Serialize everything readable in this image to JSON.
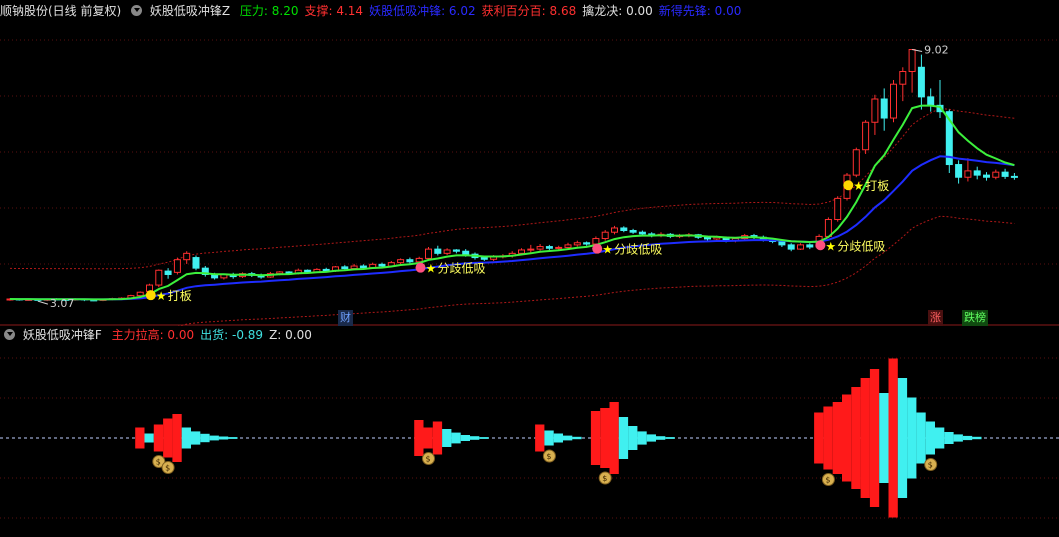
{
  "header": {
    "stock": "顺钠股份(日线 前复权)",
    "indicator": "妖股低吸冲锋Z",
    "items": [
      {
        "label": "压力: 8.20",
        "color": "#00e000"
      },
      {
        "label": "支撑: 4.14",
        "color": "#ff3030"
      },
      {
        "label": "妖股低吸冲锋: 6.02",
        "color": "#2a2aff"
      },
      {
        "label": "获利百分百: 8.68",
        "color": "#ff3030"
      },
      {
        "label": "擒龙决: 0.00",
        "color": "#e0e0e0"
      },
      {
        "label": "新得先锋: 0.00",
        "color": "#2a2aff"
      }
    ]
  },
  "sub_header": {
    "indicator": "妖股低吸冲锋F",
    "items": [
      {
        "label": "主力拉高: 0.00",
        "color": "#ff3030"
      },
      {
        "label": "出货: -0.89",
        "color": "#40e0e0"
      },
      {
        "label": "Z: 0.00",
        "color": "#e0e0e0"
      }
    ]
  },
  "tags": [
    {
      "text": "财",
      "x": 338,
      "color": "#6fa0ff",
      "bg": "#1a2a4a"
    },
    {
      "text": "涨",
      "x": 928,
      "color": "#ff6060",
      "bg": "#4a1010"
    },
    {
      "text": "跌榜",
      "x": 962,
      "color": "#60ff60",
      "bg": "#104a10"
    }
  ],
  "chart_data": [
    {
      "type": "candlestick",
      "annotations": {
        "high_label": "9.02",
        "low_label": "3.07",
        "signals": [
          {
            "text": "打板",
            "bar": 16
          },
          {
            "text": "分歧低吸",
            "bar": 45
          },
          {
            "text": "分歧低吸",
            "bar": 64
          },
          {
            "text": "分歧低吸",
            "bar": 88
          },
          {
            "text": "打板",
            "bar": 91
          }
        ]
      },
      "ylim": [
        2.6,
        9.6
      ],
      "candles": [
        [
          3.1,
          3.12,
          3.08,
          3.14
        ],
        [
          3.12,
          3.1,
          3.08,
          3.14
        ],
        [
          3.1,
          3.11,
          3.08,
          3.13
        ],
        [
          3.11,
          3.09,
          3.07,
          3.12
        ],
        [
          3.09,
          3.12,
          3.07,
          3.13
        ],
        [
          3.12,
          3.11,
          3.09,
          3.14
        ],
        [
          3.11,
          3.1,
          3.08,
          3.13
        ],
        [
          3.1,
          3.12,
          3.08,
          3.14
        ],
        [
          3.12,
          3.1,
          3.07,
          3.13
        ],
        [
          3.1,
          3.09,
          3.07,
          3.11
        ],
        [
          3.09,
          3.11,
          3.07,
          3.12
        ],
        [
          3.11,
          3.13,
          3.09,
          3.15
        ],
        [
          3.13,
          3.14,
          3.11,
          3.16
        ],
        [
          3.14,
          3.2,
          3.12,
          3.22
        ],
        [
          3.2,
          3.28,
          3.18,
          3.3
        ],
        [
          3.3,
          3.45,
          3.28,
          3.48
        ],
        [
          3.45,
          3.8,
          3.4,
          3.82
        ],
        [
          3.78,
          3.7,
          3.6,
          3.85
        ],
        [
          3.75,
          4.05,
          3.7,
          4.1
        ],
        [
          4.05,
          4.2,
          3.95,
          4.25
        ],
        [
          4.1,
          3.85,
          3.8,
          4.15
        ],
        [
          3.85,
          3.7,
          3.65,
          3.9
        ],
        [
          3.7,
          3.62,
          3.58,
          3.74
        ],
        [
          3.62,
          3.7,
          3.58,
          3.72
        ],
        [
          3.7,
          3.65,
          3.6,
          3.74
        ],
        [
          3.65,
          3.72,
          3.62,
          3.75
        ],
        [
          3.72,
          3.68,
          3.64,
          3.76
        ],
        [
          3.68,
          3.64,
          3.6,
          3.72
        ],
        [
          3.64,
          3.72,
          3.62,
          3.76
        ],
        [
          3.72,
          3.76,
          3.68,
          3.78
        ],
        [
          3.76,
          3.72,
          3.7,
          3.78
        ],
        [
          3.72,
          3.8,
          3.7,
          3.84
        ],
        [
          3.8,
          3.76,
          3.72,
          3.82
        ],
        [
          3.76,
          3.82,
          3.74,
          3.85
        ],
        [
          3.82,
          3.78,
          3.76,
          3.86
        ],
        [
          3.78,
          3.88,
          3.76,
          3.9
        ],
        [
          3.88,
          3.84,
          3.82,
          3.92
        ],
        [
          3.84,
          3.9,
          3.82,
          3.95
        ],
        [
          3.9,
          3.86,
          3.84,
          3.94
        ],
        [
          3.86,
          3.94,
          3.84,
          3.98
        ],
        [
          3.94,
          3.9,
          3.86,
          3.98
        ],
        [
          3.9,
          3.98,
          3.88,
          4.02
        ],
        [
          3.98,
          4.05,
          3.94,
          4.08
        ],
        [
          4.05,
          4.0,
          3.96,
          4.1
        ],
        [
          4.0,
          4.08,
          3.98,
          4.12
        ],
        [
          4.08,
          4.3,
          4.05,
          4.35
        ],
        [
          4.3,
          4.2,
          4.15,
          4.38
        ],
        [
          4.2,
          4.28,
          4.16,
          4.32
        ],
        [
          4.28,
          4.25,
          4.2,
          4.3
        ],
        [
          4.25,
          4.18,
          4.12,
          4.3
        ],
        [
          4.18,
          4.1,
          4.05,
          4.22
        ],
        [
          4.1,
          4.06,
          4.02,
          4.14
        ],
        [
          4.06,
          4.12,
          4.02,
          4.16
        ],
        [
          4.12,
          4.14,
          4.08,
          4.18
        ],
        [
          4.14,
          4.2,
          4.1,
          4.25
        ],
        [
          4.2,
          4.28,
          4.15,
          4.32
        ],
        [
          4.28,
          4.3,
          4.22,
          4.4
        ],
        [
          4.3,
          4.36,
          4.26,
          4.42
        ],
        [
          4.36,
          4.32,
          4.28,
          4.4
        ],
        [
          4.32,
          4.34,
          4.28,
          4.38
        ],
        [
          4.34,
          4.4,
          4.3,
          4.45
        ],
        [
          4.4,
          4.45,
          4.36,
          4.5
        ],
        [
          4.45,
          4.42,
          4.38,
          4.48
        ],
        [
          4.42,
          4.55,
          4.4,
          4.6
        ],
        [
          4.55,
          4.7,
          4.5,
          4.75
        ],
        [
          4.7,
          4.8,
          4.65,
          4.85
        ],
        [
          4.8,
          4.74,
          4.7,
          4.84
        ],
        [
          4.74,
          4.7,
          4.66,
          4.78
        ],
        [
          4.7,
          4.66,
          4.62,
          4.74
        ],
        [
          4.66,
          4.62,
          4.58,
          4.7
        ],
        [
          4.62,
          4.65,
          4.58,
          4.7
        ],
        [
          4.65,
          4.6,
          4.56,
          4.68
        ],
        [
          4.6,
          4.62,
          4.56,
          4.66
        ],
        [
          4.62,
          4.64,
          4.58,
          4.68
        ],
        [
          4.64,
          4.58,
          4.54,
          4.66
        ],
        [
          4.58,
          4.54,
          4.5,
          4.62
        ],
        [
          4.54,
          4.58,
          4.5,
          4.62
        ],
        [
          4.58,
          4.5,
          4.46,
          4.6
        ],
        [
          4.5,
          4.55,
          4.46,
          4.58
        ],
        [
          4.55,
          4.62,
          4.52,
          4.66
        ],
        [
          4.62,
          4.58,
          4.54,
          4.66
        ],
        [
          4.58,
          4.52,
          4.48,
          4.62
        ],
        [
          4.52,
          4.48,
          4.44,
          4.56
        ],
        [
          4.48,
          4.4,
          4.35,
          4.52
        ],
        [
          4.4,
          4.3,
          4.25,
          4.44
        ],
        [
          4.3,
          4.4,
          4.28,
          4.44
        ],
        [
          4.4,
          4.35,
          4.3,
          4.44
        ],
        [
          4.35,
          4.6,
          4.32,
          4.65
        ],
        [
          4.6,
          5.0,
          4.58,
          5.05
        ],
        [
          5.0,
          5.5,
          4.95,
          5.55
        ],
        [
          5.5,
          6.05,
          5.45,
          6.1
        ],
        [
          6.05,
          6.65,
          6.0,
          6.7
        ],
        [
          6.65,
          7.3,
          6.55,
          7.35
        ],
        [
          7.3,
          7.85,
          7.0,
          7.95
        ],
        [
          7.85,
          7.4,
          7.1,
          8.1
        ],
        [
          7.4,
          8.2,
          7.3,
          8.3
        ],
        [
          8.2,
          8.5,
          7.8,
          8.6
        ],
        [
          8.5,
          9.02,
          8.0,
          9.02
        ],
        [
          8.6,
          7.9,
          7.6,
          8.9
        ],
        [
          7.9,
          7.7,
          7.55,
          8.1
        ],
        [
          7.7,
          7.55,
          7.4,
          8.3
        ],
        [
          7.55,
          6.3,
          6.1,
          7.6
        ],
        [
          6.3,
          6.0,
          5.85,
          6.4
        ],
        [
          6.0,
          6.15,
          5.9,
          6.45
        ],
        [
          6.15,
          6.05,
          5.95,
          6.25
        ],
        [
          6.05,
          6.0,
          5.92,
          6.12
        ],
        [
          6.0,
          6.12,
          5.95,
          6.18
        ],
        [
          6.12,
          6.02,
          5.96,
          6.2
        ],
        [
          6.02,
          6.0,
          5.94,
          6.1
        ]
      ]
    },
    {
      "type": "bar",
      "ylim": [
        -3,
        3
      ],
      "signal_bars": [
        16,
        17,
        45,
        58,
        64,
        88,
        99
      ],
      "bars": [
        {
          "bar": 14,
          "value": 0.35,
          "color": "red"
        },
        {
          "bar": 15,
          "value": 0.15,
          "color": "cyan"
        },
        {
          "bar": 16,
          "value": 0.45,
          "color": "red"
        },
        {
          "bar": 17,
          "value": 0.65,
          "color": "red"
        },
        {
          "bar": 18,
          "value": 0.8,
          "color": "red"
        },
        {
          "bar": 19,
          "value": 0.35,
          "color": "cyan"
        },
        {
          "bar": 20,
          "value": 0.22,
          "color": "cyan"
        },
        {
          "bar": 21,
          "value": 0.14,
          "color": "cyan"
        },
        {
          "bar": 22,
          "value": 0.08,
          "color": "cyan"
        },
        {
          "bar": 23,
          "value": 0.05,
          "color": "cyan"
        },
        {
          "bar": 24,
          "value": 0.03,
          "color": "cyan"
        },
        {
          "bar": 44,
          "value": 0.6,
          "color": "red"
        },
        {
          "bar": 45,
          "value": 0.35,
          "color": "red"
        },
        {
          "bar": 46,
          "value": 0.55,
          "color": "red"
        },
        {
          "bar": 47,
          "value": 0.3,
          "color": "cyan"
        },
        {
          "bar": 48,
          "value": 0.18,
          "color": "cyan"
        },
        {
          "bar": 49,
          "value": 0.1,
          "color": "cyan"
        },
        {
          "bar": 50,
          "value": 0.06,
          "color": "cyan"
        },
        {
          "bar": 51,
          "value": 0.03,
          "color": "cyan"
        },
        {
          "bar": 57,
          "value": 0.45,
          "color": "red"
        },
        {
          "bar": 58,
          "value": 0.25,
          "color": "cyan"
        },
        {
          "bar": 59,
          "value": 0.15,
          "color": "cyan"
        },
        {
          "bar": 60,
          "value": 0.08,
          "color": "cyan"
        },
        {
          "bar": 61,
          "value": 0.04,
          "color": "cyan"
        },
        {
          "bar": 63,
          "value": 0.9,
          "color": "red"
        },
        {
          "bar": 64,
          "value": 1.0,
          "color": "red"
        },
        {
          "bar": 65,
          "value": 1.2,
          "color": "red"
        },
        {
          "bar": 66,
          "value": 0.7,
          "color": "cyan"
        },
        {
          "bar": 67,
          "value": 0.4,
          "color": "cyan"
        },
        {
          "bar": 68,
          "value": 0.22,
          "color": "cyan"
        },
        {
          "bar": 69,
          "value": 0.12,
          "color": "cyan"
        },
        {
          "bar": 70,
          "value": 0.06,
          "color": "cyan"
        },
        {
          "bar": 71,
          "value": 0.03,
          "color": "cyan"
        },
        {
          "bar": 87,
          "value": 0.85,
          "color": "red"
        },
        {
          "bar": 88,
          "value": 1.05,
          "color": "red"
        },
        {
          "bar": 89,
          "value": 1.2,
          "color": "red"
        },
        {
          "bar": 90,
          "value": 1.45,
          "color": "red"
        },
        {
          "bar": 91,
          "value": 1.7,
          "color": "red"
        },
        {
          "bar": 92,
          "value": 2.0,
          "color": "red"
        },
        {
          "bar": 93,
          "value": 2.3,
          "color": "red"
        },
        {
          "bar": 94,
          "value": 1.5,
          "color": "cyan"
        },
        {
          "bar": 95,
          "value": 2.65,
          "color": "red"
        },
        {
          "bar": 96,
          "value": 2.0,
          "color": "cyan"
        },
        {
          "bar": 97,
          "value": 1.35,
          "color": "cyan"
        },
        {
          "bar": 98,
          "value": 0.85,
          "color": "cyan"
        },
        {
          "bar": 99,
          "value": 0.55,
          "color": "cyan"
        },
        {
          "bar": 100,
          "value": 0.35,
          "color": "cyan"
        },
        {
          "bar": 101,
          "value": 0.2,
          "color": "cyan"
        },
        {
          "bar": 102,
          "value": 0.12,
          "color": "cyan"
        },
        {
          "bar": 103,
          "value": 0.07,
          "color": "cyan"
        },
        {
          "bar": 104,
          "value": 0.04,
          "color": "cyan"
        }
      ]
    }
  ]
}
